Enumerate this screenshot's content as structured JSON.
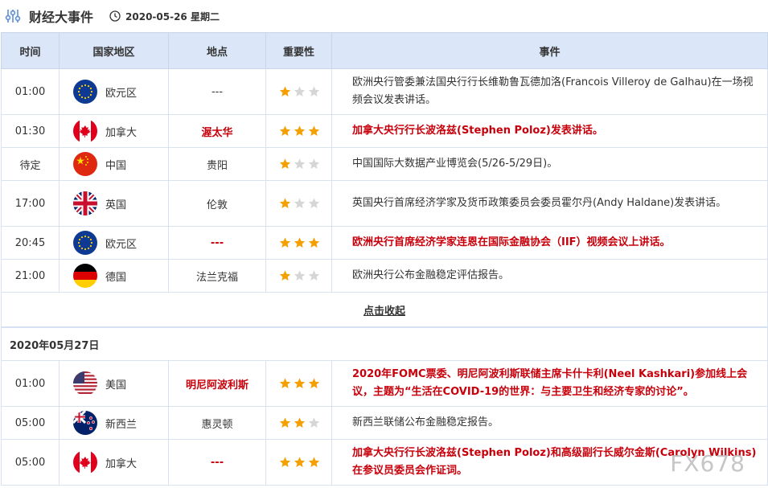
{
  "header": {
    "title": "财经大事件",
    "date": "2020-05-26 星期二"
  },
  "columns": [
    "时间",
    "国家地区",
    "地点",
    "重要性",
    "事件"
  ],
  "collapse_label": "点击收起",
  "day1": [
    {
      "time": "01:00",
      "country": "欧元区",
      "flag": "eu",
      "location": "---",
      "stars": 1,
      "important": false,
      "event": "欧洲央行管委兼法国央行行长维勒鲁瓦德加洛(Francois Villeroy de Galhau)在一场视频会议发表讲话。"
    },
    {
      "time": "01:30",
      "country": "加拿大",
      "flag": "ca",
      "location": "渥太华",
      "stars": 3,
      "important": true,
      "event": "加拿大央行行长波洛兹(Stephen Poloz)发表讲话。"
    },
    {
      "time": "待定",
      "country": "中国",
      "flag": "cn",
      "location": "贵阳",
      "stars": 1,
      "important": false,
      "event": "中国国际大数据产业博览会(5/26-5/29日)。"
    },
    {
      "time": "17:00",
      "country": "英国",
      "flag": "gb",
      "location": "伦敦",
      "stars": 1,
      "important": false,
      "event": "英国央行首席经济学家及货币政策委员会委员霍尔丹(Andy Haldane)发表讲话。"
    },
    {
      "time": "20:45",
      "country": "欧元区",
      "flag": "eu",
      "location": "---",
      "stars": 3,
      "important": true,
      "event": "欧洲央行首席经济学家连恩在国际金融协会（IIF）视频会议上讲话。"
    },
    {
      "time": "21:00",
      "country": "德国",
      "flag": "de",
      "location": "法兰克福",
      "stars": 1,
      "important": false,
      "event": "欧洲央行公布金融稳定评估报告。"
    }
  ],
  "day2_label": "2020年05月27日",
  "day2": [
    {
      "time": "01:00",
      "country": "美国",
      "flag": "us",
      "location": "明尼阿波利斯",
      "stars": 3,
      "important": true,
      "event": "2020年FOMC票委、明尼阿波利斯联储主席卡什卡利(Neel Kashkari)参加线上会议，主题为“生活在COVID-19的世界：与主要卫生和经济专家的讨论”。"
    },
    {
      "time": "05:00",
      "country": "新西兰",
      "flag": "nz",
      "location": "惠灵顿",
      "stars": 2,
      "important": false,
      "event": "新西兰联储公布金融稳定报告。"
    },
    {
      "time": "05:00",
      "country": "加拿大",
      "flag": "ca",
      "location": "---",
      "stars": 3,
      "important": true,
      "event": "加拿大央行行长波洛兹(Stephen Poloz)和高级副行长威尔金斯(Carolyn Wilkins)在参议员委员会作证词。"
    }
  ],
  "watermark": "FX678",
  "colors": {
    "header_bg": "#dbe7f8",
    "important_text": "#c7000b",
    "star_on": "#f5a000",
    "star_off": "#d6d6d6"
  }
}
